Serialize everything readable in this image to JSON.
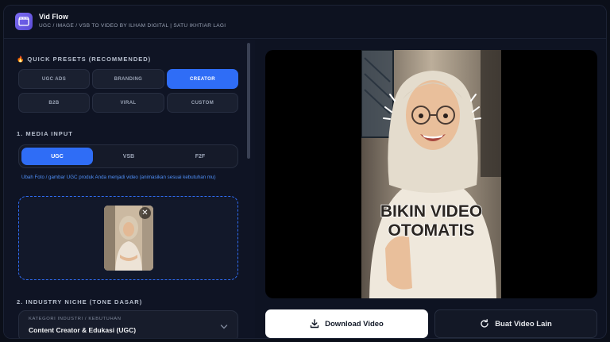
{
  "app": {
    "title": "Vid Flow",
    "subtitle": "UGC / IMAGE / VSB TO VIDEO BY ILHAM DIGITAL | SATU IKHTIAR LAGI",
    "accent": "#2f6df6"
  },
  "presets": {
    "title": "🔥 QUICK PRESETS (RECOMMENDED)",
    "items": [
      {
        "label": "UGC ADS",
        "active": false
      },
      {
        "label": "BRANDING",
        "active": false
      },
      {
        "label": "CREATOR",
        "active": true
      },
      {
        "label": "B2B",
        "active": false
      },
      {
        "label": "VIRAL",
        "active": false
      },
      {
        "label": "CUSTOM",
        "active": false
      }
    ]
  },
  "media_input": {
    "title": "1. MEDIA INPUT",
    "tabs": [
      {
        "label": "UGC",
        "active": true
      },
      {
        "label": "VSB",
        "active": false
      },
      {
        "label": "F2F",
        "active": false
      }
    ],
    "hint": "Ubah Foto / gambar UGC produk Anda menjadi video (animasikan sesuai kebutuhan mu)",
    "remove_symbol": "✕"
  },
  "industry": {
    "title": "2. INDUSTRY NICHE (TONE DASAR)",
    "select_label": "KATEGORI INDUSTRI / KEBUTUHAN",
    "select_value": "Content Creator & Edukasi (UGC)"
  },
  "video": {
    "overlay_line1": "BIKIN VIDEO",
    "overlay_line2": "OTOMATIS"
  },
  "actions": {
    "download_label": "Download Video",
    "download_icon": "download-icon",
    "new_label": "Buat Video Lain",
    "new_icon": "refresh-icon"
  }
}
